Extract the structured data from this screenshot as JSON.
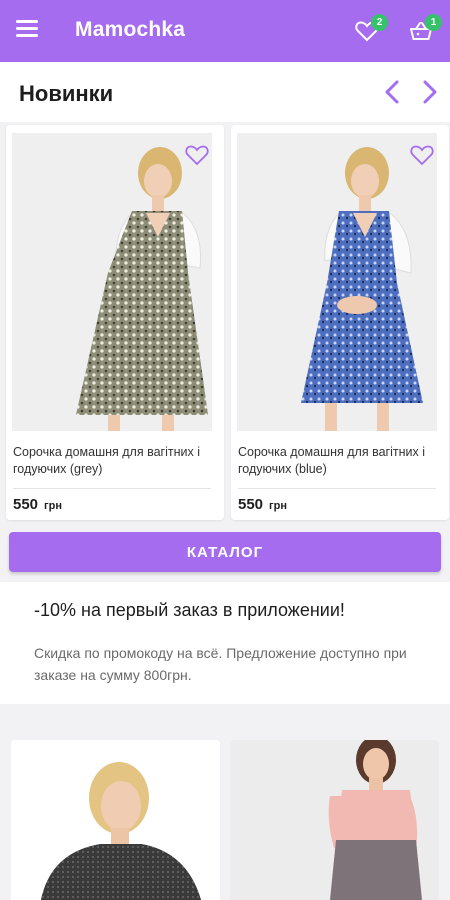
{
  "app": {
    "title": "Mamochka"
  },
  "header": {
    "favorites_count": "2",
    "cart_count": "1"
  },
  "section": {
    "title": "Новинки"
  },
  "products": [
    {
      "name": "Сорочка домашня для вагітних і годуючих (grey)",
      "price": "550",
      "currency": "грн"
    },
    {
      "name": "Сорочка домашня для вагітних і годуючих (blue)",
      "price": "550",
      "currency": "грн"
    }
  ],
  "catalog_button": {
    "label": "КАТАЛОГ"
  },
  "promo": {
    "title": "-10% на первый заказ в приложении!",
    "text": "Скидка по промокоду на всё. Предложение доступно при заказе на сумму 800грн."
  },
  "colors": {
    "accent": "#a66cf0",
    "badge": "#35c26b",
    "heart": "#a66cf0"
  }
}
